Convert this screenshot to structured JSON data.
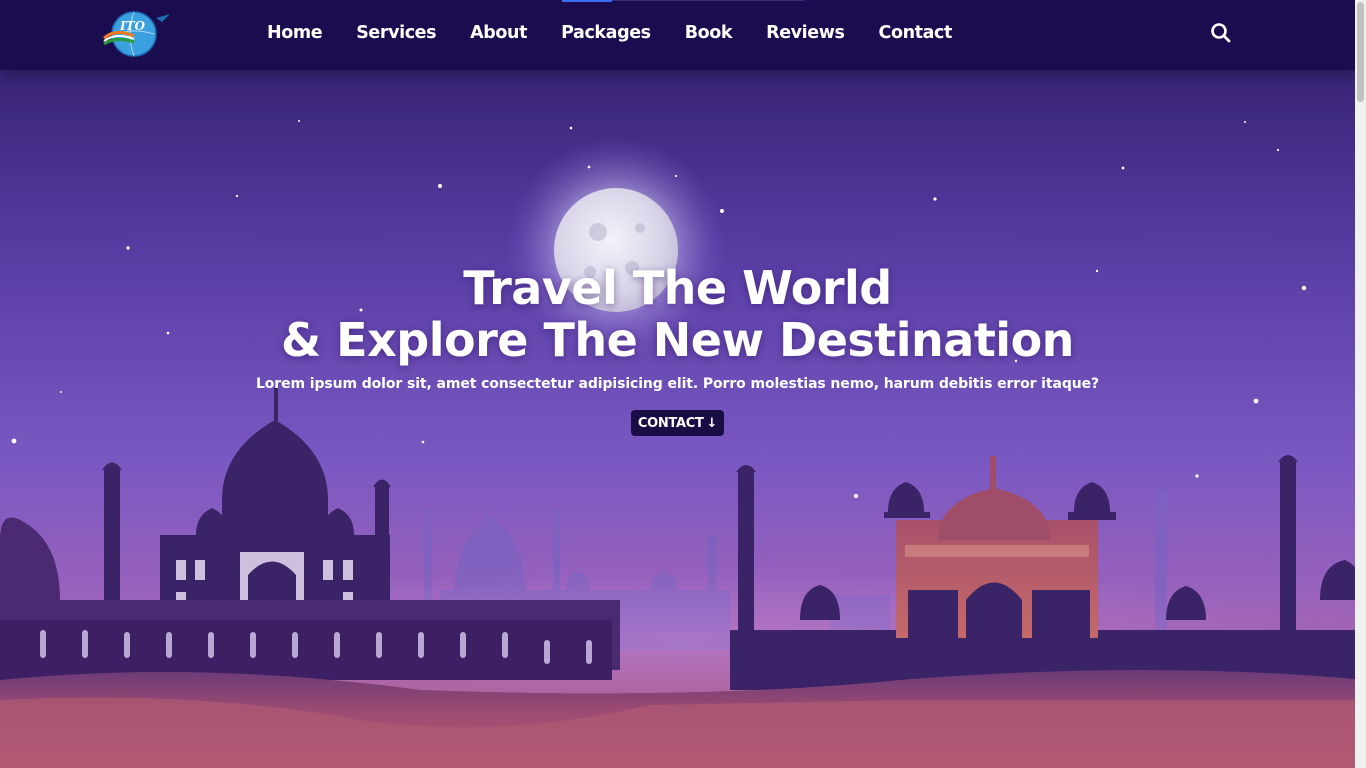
{
  "brand": {
    "logo_text": "ITO"
  },
  "nav": {
    "items": [
      {
        "label": "Home"
      },
      {
        "label": "Services"
      },
      {
        "label": "About"
      },
      {
        "label": "Packages"
      },
      {
        "label": "Book"
      },
      {
        "label": "Reviews"
      },
      {
        "label": "Contact"
      }
    ],
    "search_icon": "search-icon"
  },
  "hero": {
    "title_line1": "Travel The World",
    "title_line2": "& Explore The New Destination",
    "subtitle": "Lorem ipsum dolor sit, amet consectetur adipisicing elit. Porro molestias nemo, harum debitis error itaque?",
    "cta_label": "CONTACT",
    "cta_icon": "arrow-down-icon"
  },
  "colors": {
    "nav_bg": "#1b0c4f",
    "sky_top": "#2a1a6a",
    "sky_mid": "#6a4cb8",
    "sky_low": "#9a6ad0",
    "ground": "#a8506e",
    "button_bg": "#1a0c45",
    "accent": "#3a6df0"
  }
}
